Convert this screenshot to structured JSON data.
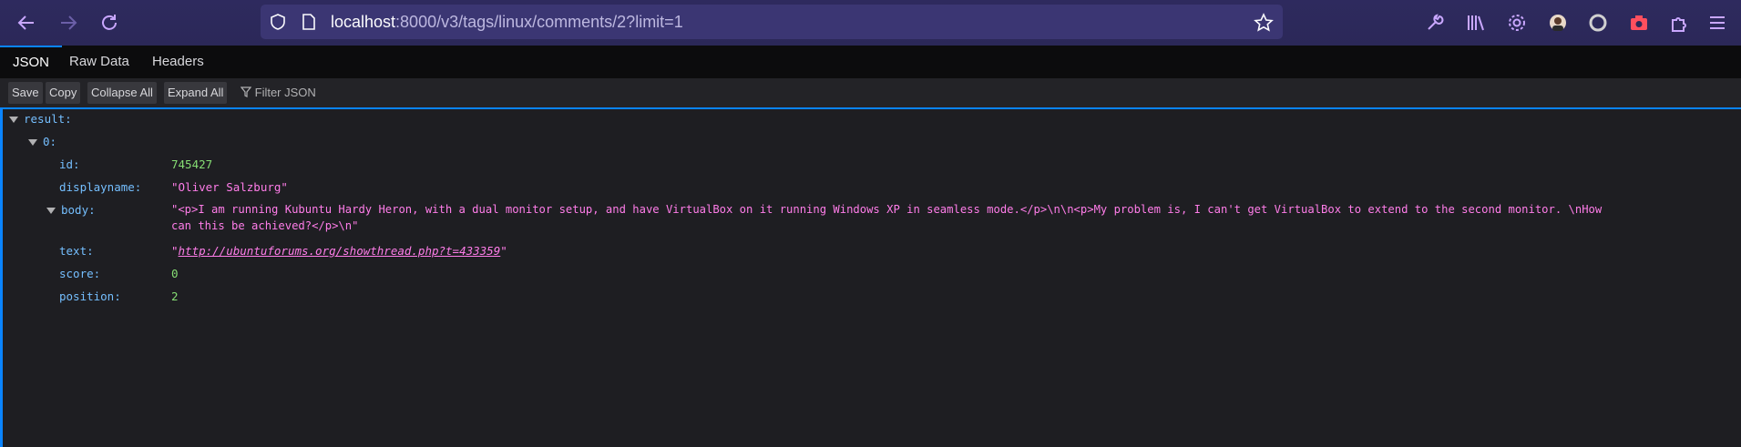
{
  "browser": {
    "url_host": "localhost",
    "url_rest": ":8000/v3/tags/linux/comments/2?limit=1"
  },
  "viewer": {
    "tabs": [
      "JSON",
      "Raw Data",
      "Headers"
    ],
    "buttons": [
      "Save",
      "Copy",
      "Collapse All",
      "Expand All"
    ],
    "filter_placeholder": "Filter JSON"
  },
  "json": {
    "root_key": "result:",
    "item_key": "0:",
    "fields": {
      "id": {
        "key": "id:",
        "value": "745427"
      },
      "displayname": {
        "key": "displayname:",
        "value": "\"Oliver Salzburg\""
      },
      "body": {
        "key": "body:",
        "line1": "\"<p>I am running Kubuntu Hardy Heron, with a dual monitor setup, and have VirtualBox on it running Windows XP in seamless mode.</p>\\n\\n<p>My problem is, I can't get VirtualBox to extend to the second monitor. \\nHow",
        "line2": "can this be achieved?</p>\\n\""
      },
      "text": {
        "key": "text:",
        "value": "http://ubuntuforums.org/showthread.php?t=433359"
      },
      "score": {
        "key": "score:",
        "value": "0"
      },
      "position": {
        "key": "position:",
        "value": "2"
      }
    }
  }
}
